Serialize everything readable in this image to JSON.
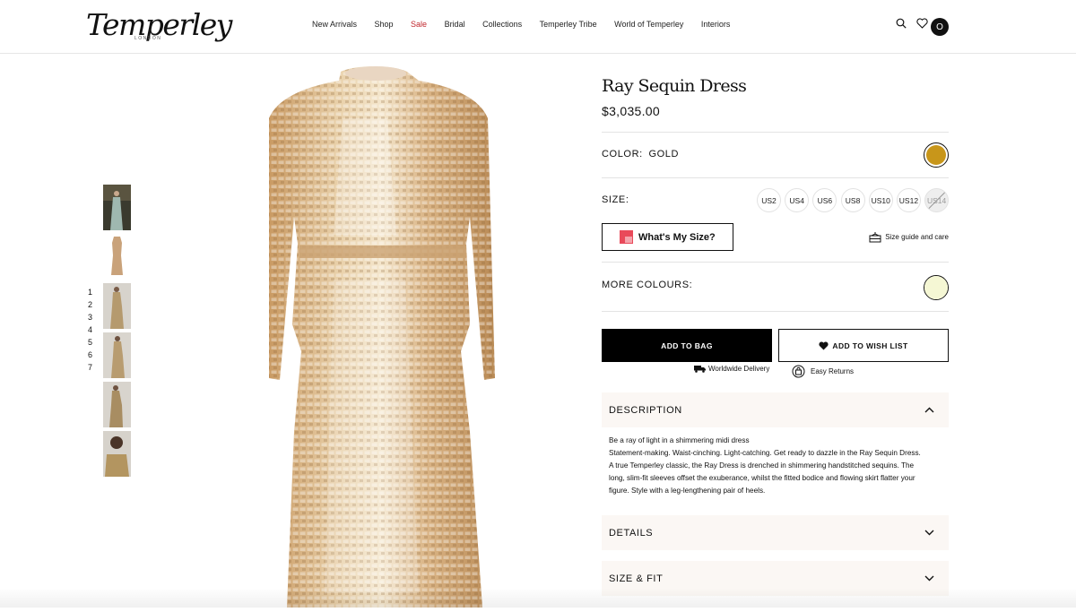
{
  "brand": {
    "name": "Temperley",
    "sub": "LONDON"
  },
  "nav": [
    "New Arrivals",
    "Shop",
    "Sale",
    "Bridal",
    "Collections",
    "Temperley Tribe",
    "World of Temperley",
    "Interiors"
  ],
  "header_icons": [
    "search-icon",
    "heart-icon",
    "bag-icon"
  ],
  "avatar_initial": "O",
  "thumb_numbers": [
    "1",
    "2",
    "3",
    "4",
    "5",
    "6",
    "7"
  ],
  "product": {
    "title": "Ray Sequin Dress",
    "price": "$3,035.00",
    "color_label": "COLOR:",
    "color_value": "GOLD",
    "color_swatch": "#c8961a",
    "size_label": "SIZE:",
    "sizes": [
      "US2",
      "US4",
      "US6",
      "US8",
      "US10",
      "US12",
      "US14"
    ],
    "unavailable_size": "US14",
    "whats_my_size": "What's My Size?",
    "size_guide": "Size guide and care",
    "more_colours_label": "MORE COLOURS:",
    "more_colours_swatch": "#f5f7d4",
    "add_to_bag": "ADD TO BAG",
    "add_to_wishlist": "ADD TO WISH LIST",
    "worldwide_delivery": "Worldwide Delivery",
    "easy_returns": "Easy Returns"
  },
  "accordions": {
    "description": "DESCRIPTION",
    "details": "DETAILS",
    "size_fit": "SIZE & FIT"
  },
  "description_lines": [
    "Be a ray of light in a shimmering midi dress",
    "Statement-making. Waist-cinching. Light-catching. Get ready to dazzle in the Ray Sequin Dress.",
    "A true Temperley classic, the Ray Dress is drenched in shimmering handstitched sequins. The",
    "long, slim-fit sleeves offset the exuberance, whilst the fitted bodice and flowing skirt flatter your",
    "figure. Style with a leg-lengthening pair of heels."
  ]
}
